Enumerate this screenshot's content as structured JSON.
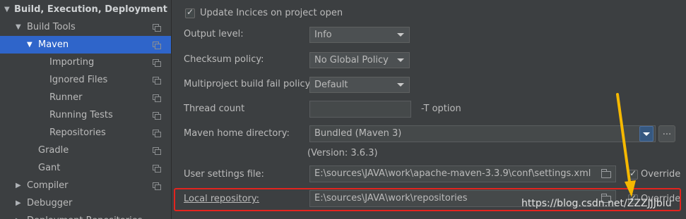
{
  "sidebar": {
    "items": [
      {
        "label": "Build, Execution, Deployment",
        "arrow": "▼",
        "bold": true
      },
      {
        "label": "Build Tools",
        "arrow": "▼"
      },
      {
        "label": "Maven",
        "arrow": "▼",
        "selected": true
      },
      {
        "label": "Importing"
      },
      {
        "label": "Ignored Files"
      },
      {
        "label": "Runner"
      },
      {
        "label": "Running Tests"
      },
      {
        "label": "Repositories"
      },
      {
        "label": "Gradle"
      },
      {
        "label": "Gant"
      },
      {
        "label": "Compiler",
        "arrow": "▶"
      },
      {
        "label": "Debugger",
        "arrow": "▶"
      },
      {
        "label": "Deployment Repositories",
        "arrow": "▶"
      }
    ]
  },
  "settings": {
    "update_indices": {
      "label": "Update Incices on project open",
      "checked": true
    },
    "output_level": {
      "label": "Output level:",
      "value": "Info"
    },
    "checksum_policy": {
      "label": "Checksum policy:",
      "value": "No Global Policy"
    },
    "multiproject_policy": {
      "label": "Multiproject build fail policy:",
      "value": "Default"
    },
    "thread_count": {
      "label": "Thread count",
      "value": "",
      "suffix": "-T option"
    },
    "maven_home": {
      "label": "Maven home directory:",
      "value": "Bundled (Maven 3)",
      "browse_label": "...",
      "version": "(Version: 3.6.3)"
    },
    "user_settings": {
      "label": "User settings file:",
      "value": "E:\\sources\\JAVA\\work\\apache-maven-3.3.9\\conf\\settings.xml",
      "override_label": "Override",
      "override_checked": true
    },
    "local_repository": {
      "label": "Local repository:",
      "value": "E:\\sources\\JAVA\\work\\repositories",
      "override_label": "Override",
      "override_checked": true
    }
  },
  "annotation": {
    "highlight_color": "#e3241e",
    "arrow_color": "#f5b800"
  },
  "watermark": "https://blog.csdn.net/ZZZJJJbiu",
  "colors": {
    "background": "#3c3f41",
    "selection": "#2f65ca",
    "text": "#bbbbbb"
  }
}
